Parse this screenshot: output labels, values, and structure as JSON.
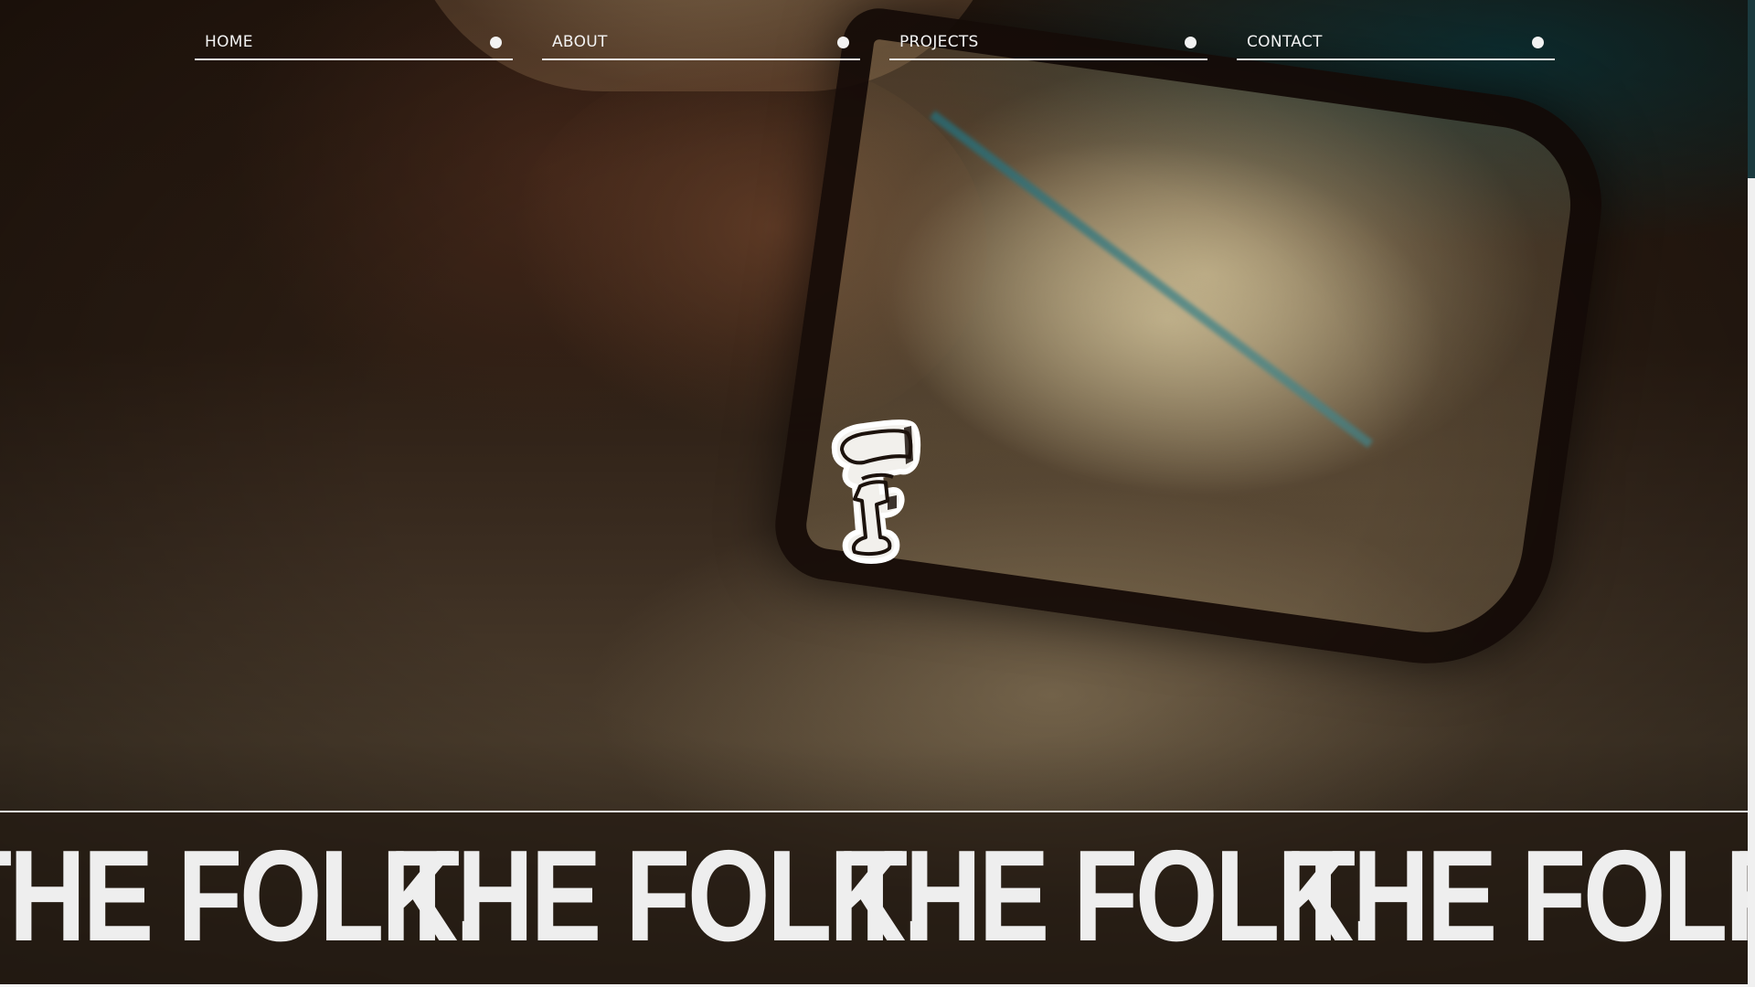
{
  "nav": {
    "items": [
      {
        "label": "HOME"
      },
      {
        "label": "ABOUT"
      },
      {
        "label": "PROJECTS"
      },
      {
        "label": "CONTACT"
      }
    ]
  },
  "marquee": {
    "items": [
      "THE FOLK.",
      "THE FOLK.",
      "THE FOLK.",
      "THE FOLK.",
      "THE FOLK."
    ]
  },
  "logo": {
    "icon": "folk-f-logo-icon",
    "colors": {
      "fill": "#f2f0ec",
      "outline": "#ffffff",
      "stroke": "#1c120c"
    }
  },
  "theme": {
    "text": "#f2f2f2",
    "band": "#261c14",
    "scroll_thumb": "#1b3b3f"
  }
}
